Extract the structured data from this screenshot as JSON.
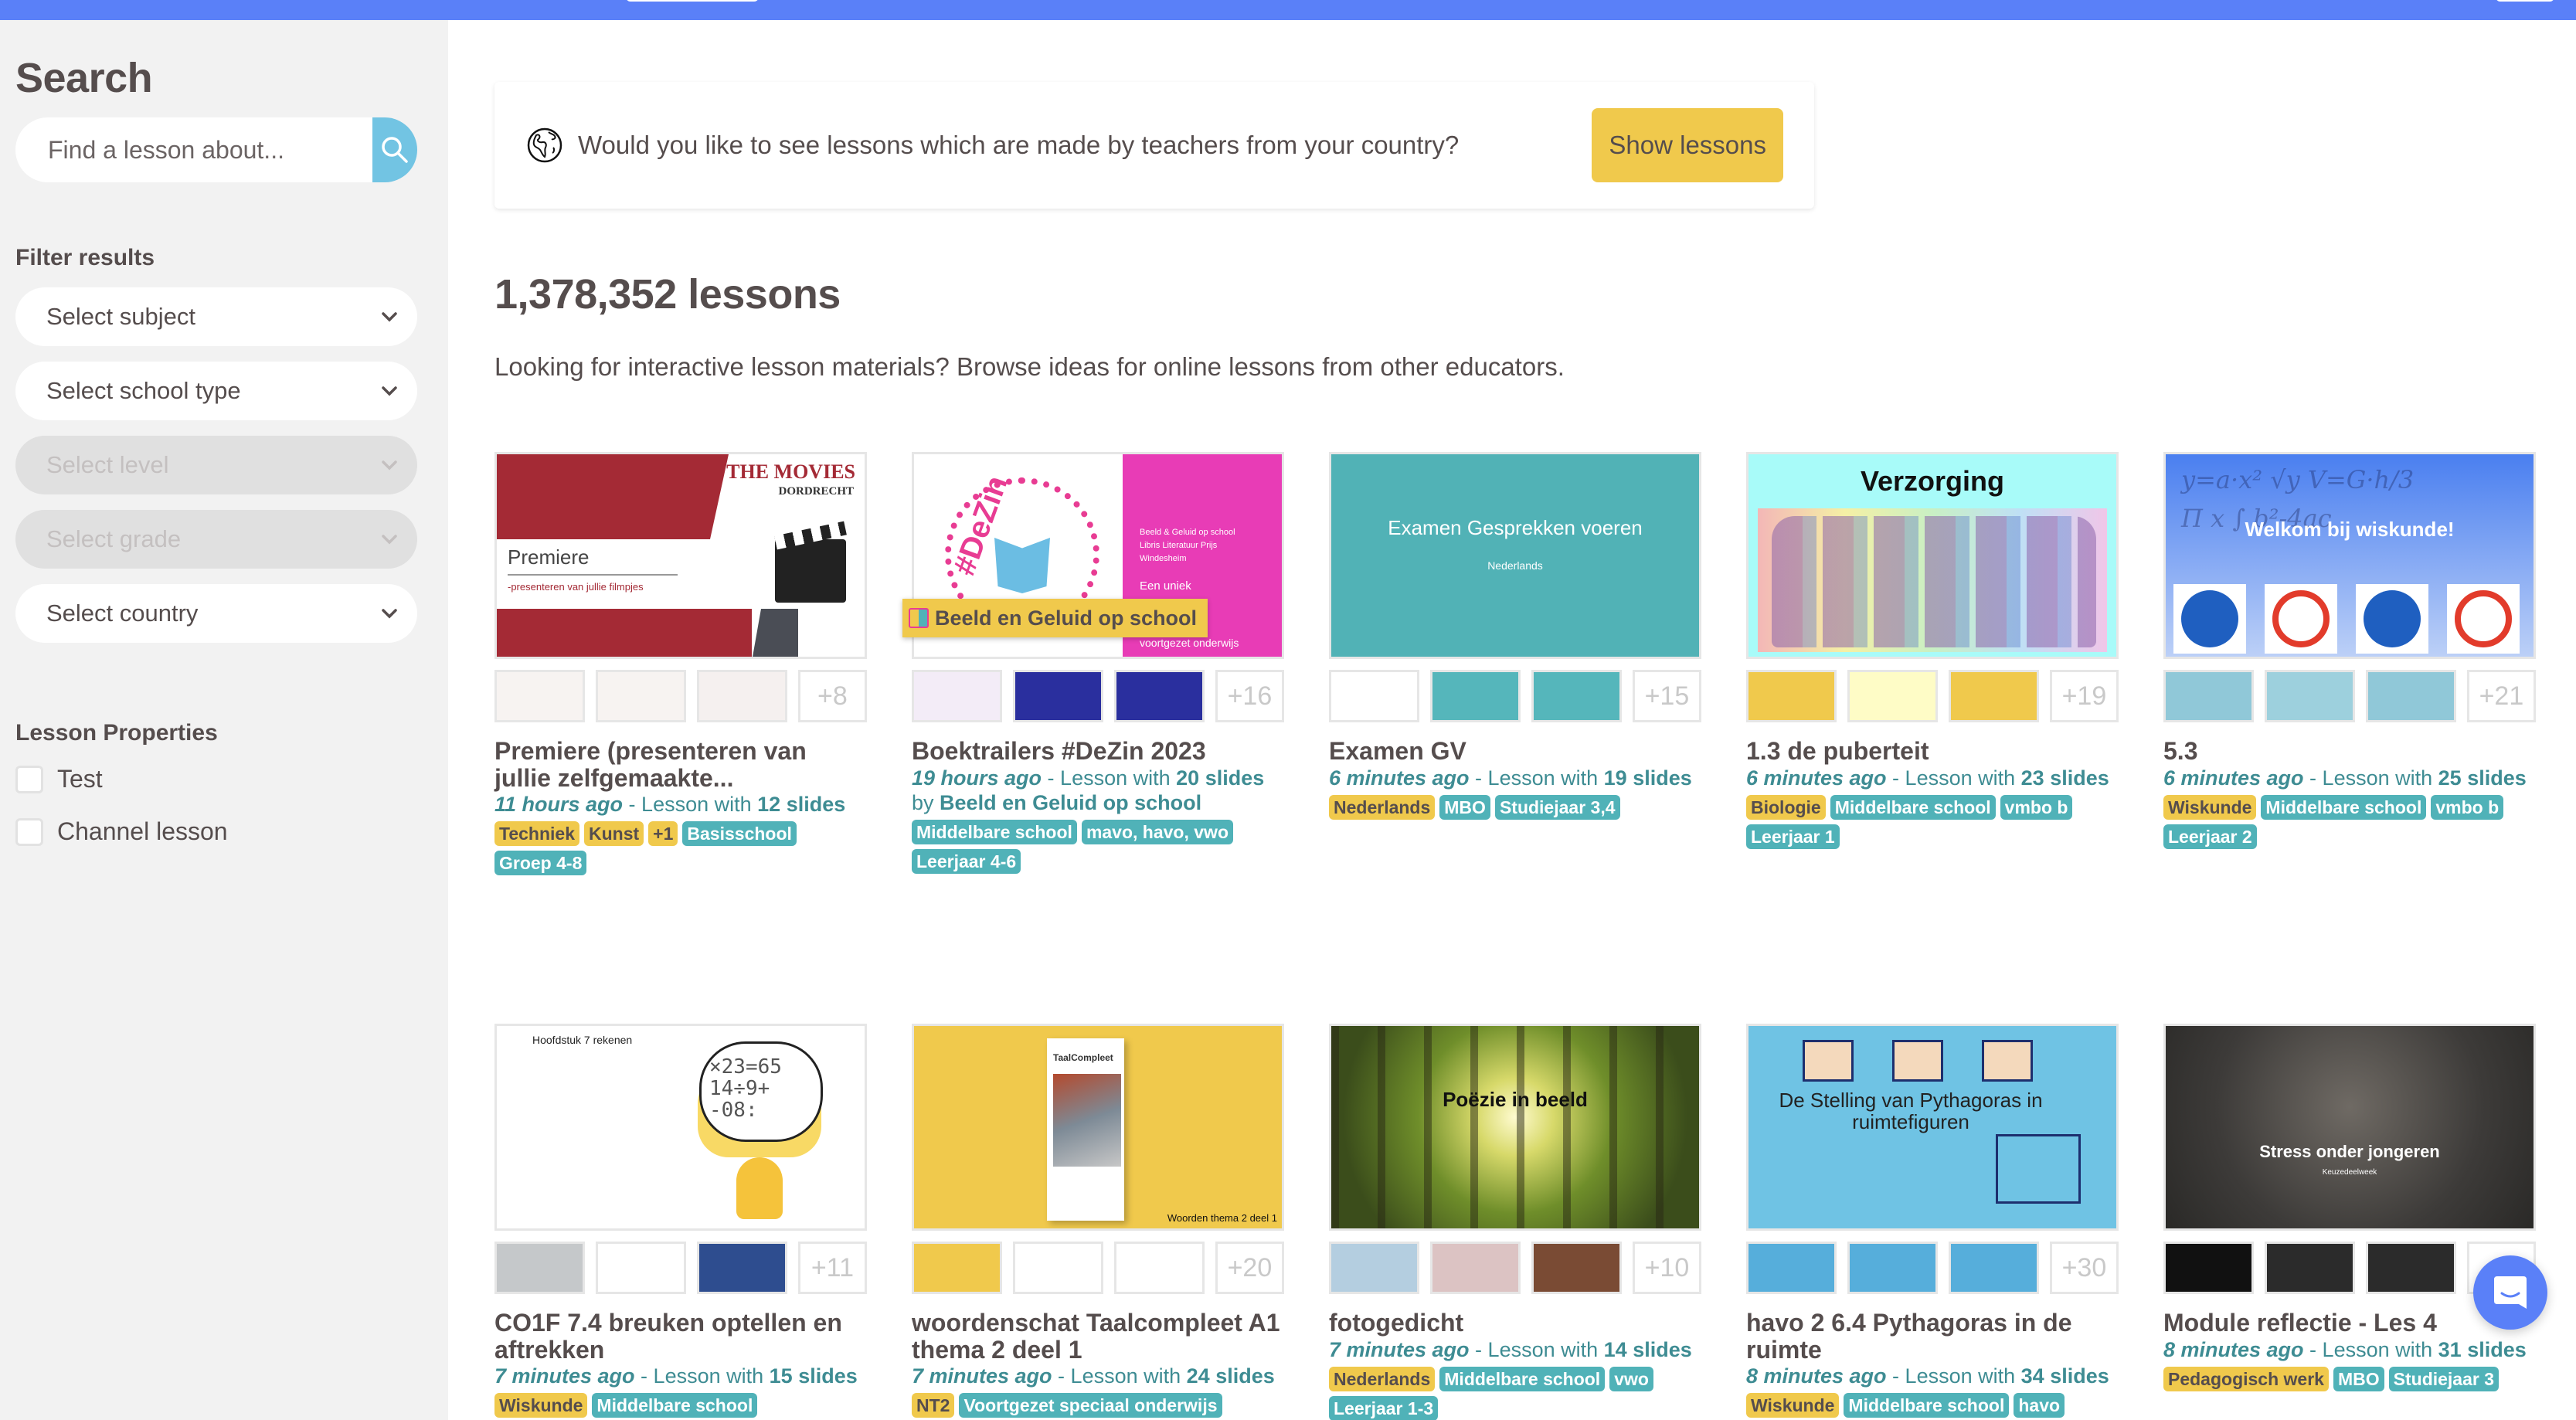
{
  "sidebar": {
    "title": "Search",
    "search": {
      "placeholder": "Find a lesson about...",
      "value": ""
    },
    "filter_title": "Filter results",
    "selects": [
      {
        "label": "Select subject",
        "disabled": false
      },
      {
        "label": "Select school type",
        "disabled": false
      },
      {
        "label": "Select level",
        "disabled": true
      },
      {
        "label": "Select grade",
        "disabled": true
      },
      {
        "label": "Select country",
        "disabled": false
      }
    ],
    "properties_title": "Lesson Properties",
    "checkboxes": [
      {
        "label": "Test",
        "checked": false
      },
      {
        "label": "Channel lesson",
        "checked": false
      }
    ]
  },
  "banner": {
    "text": "Would you like to see lessons which are made by teachers from your country?",
    "button": "Show lessons"
  },
  "results": {
    "count_title": "1,378,352 lessons",
    "description": "Looking for interactive lesson materials? Browse ideas for online lessons from other educators."
  },
  "colors": {
    "topbar": "#5a80f8",
    "accent_yellow": "#f0c94c",
    "accent_teal": "#50b2b8",
    "search_button": "#72c4e3",
    "text": "#554d4d"
  },
  "lessons": [
    {
      "title": "Premiere (presenteren van jullie zelfgemaakte...",
      "ago": "11 hours ago",
      "lesson_with": "Lesson with",
      "slides": "12 slides",
      "more": "+8",
      "thumb_text": [
        "Premiere",
        "-presenteren van jullie filmpjes",
        "THE MOVIES",
        "DORDRECHT"
      ],
      "tags": [
        {
          "text": "Techniek",
          "kind": "subj"
        },
        {
          "text": "Kunst",
          "kind": "subj"
        },
        {
          "text": "+1",
          "kind": "subj"
        },
        {
          "text": "Basisschool",
          "kind": "lvl"
        },
        {
          "text": "Groep 4-8",
          "kind": "lvl"
        }
      ]
    },
    {
      "title": "Boektrailers #DeZin 2023",
      "ago": "19 hours ago",
      "lesson_with": "Lesson with",
      "slides": "20 slides",
      "by": "by",
      "author": "Beeld en Geluid op school",
      "more": "+16",
      "thumb_text": [
        "#DeZin",
        "Beeld & Geluid op school",
        "Libris Literatuur Prijs",
        "Windesheim",
        "Een uniek",
        "voortgezet onderwijs"
      ],
      "tags": [
        {
          "text": "Middelbare school",
          "kind": "lvl"
        },
        {
          "text": "mavo, havo, vwo",
          "kind": "lvl"
        },
        {
          "text": "Leerjaar 4-6",
          "kind": "lvl"
        }
      ]
    },
    {
      "title": "Examen GV",
      "ago": "6 minutes ago",
      "lesson_with": "Lesson with",
      "slides": "19 slides",
      "more": "+15",
      "thumb_text": [
        "Examen Gesprekken voeren",
        "Nederlands"
      ],
      "tags": [
        {
          "text": "Nederlands",
          "kind": "subj"
        },
        {
          "text": "MBO",
          "kind": "lvl"
        },
        {
          "text": "Studiejaar 3,4",
          "kind": "lvl"
        }
      ]
    },
    {
      "title": "1.3 de puberteit",
      "ago": "6 minutes ago",
      "lesson_with": "Lesson with",
      "slides": "23 slides",
      "more": "+19",
      "thumb_text": [
        "Verzorging"
      ],
      "tags": [
        {
          "text": "Biologie",
          "kind": "subj"
        },
        {
          "text": "Middelbare school",
          "kind": "lvl"
        },
        {
          "text": "vmbo b",
          "kind": "lvl"
        },
        {
          "text": "Leerjaar 1",
          "kind": "lvl"
        }
      ]
    },
    {
      "title": "5.3",
      "ago": "6 minutes ago",
      "lesson_with": "Lesson with",
      "slides": "25 slides",
      "more": "+21",
      "thumb_text": [
        "Welkom bij wiskunde!"
      ],
      "tags": [
        {
          "text": "Wiskunde",
          "kind": "subj"
        },
        {
          "text": "Middelbare school",
          "kind": "lvl"
        },
        {
          "text": "vmbo b",
          "kind": "lvl"
        },
        {
          "text": "Leerjaar 2",
          "kind": "lvl"
        }
      ]
    },
    {
      "title": "CO1F 7.4 breuken optellen en aftrekken",
      "ago": "7 minutes ago",
      "lesson_with": "Lesson with",
      "slides": "15 slides",
      "more": "+11",
      "thumb_text": [
        "Hoofdstuk 7 rekenen"
      ],
      "tags": [
        {
          "text": "Wiskunde",
          "kind": "subj"
        },
        {
          "text": "Middelbare school",
          "kind": "lvl"
        }
      ]
    },
    {
      "title": "woordenschat Taalcompleet A1 thema 2 deel 1",
      "ago": "7 minutes ago",
      "lesson_with": "Lesson with",
      "slides": "24 slides",
      "more": "+20",
      "thumb_text": [
        "TaalCompleet",
        "Woorden thema 2 deel 1"
      ],
      "tags": [
        {
          "text": "NT2",
          "kind": "subj"
        },
        {
          "text": "Voortgezet speciaal onderwijs",
          "kind": "lvl"
        }
      ]
    },
    {
      "title": "fotogedicht",
      "ago": "7 minutes ago",
      "lesson_with": "Lesson with",
      "slides": "14 slides",
      "more": "+10",
      "thumb_text": [
        "Poëzie in beeld"
      ],
      "tags": [
        {
          "text": "Nederlands",
          "kind": "subj"
        },
        {
          "text": "Middelbare school",
          "kind": "lvl"
        },
        {
          "text": "vwo",
          "kind": "lvl"
        },
        {
          "text": "Leerjaar 1-3",
          "kind": "lvl"
        }
      ]
    },
    {
      "title": "havo 2 6.4 Pythagoras in de ruimte",
      "ago": "8 minutes ago",
      "lesson_with": "Lesson with",
      "slides": "34 slides",
      "more": "+30",
      "thumb_text": [
        "De Stelling van Pythagoras in ruimtefiguren"
      ],
      "tags": [
        {
          "text": "Wiskunde",
          "kind": "subj"
        },
        {
          "text": "Middelbare school",
          "kind": "lvl"
        },
        {
          "text": "havo",
          "kind": "lvl"
        }
      ]
    },
    {
      "title": "Module reflectie - Les 4",
      "ago": "8 minutes ago",
      "lesson_with": "Lesson with",
      "slides": "31 slides",
      "more": "+",
      "thumb_text": [
        "Stress onder jongeren",
        "Keuzedeelweek"
      ],
      "tags": [
        {
          "text": "Pedagogisch werk",
          "kind": "subj"
        },
        {
          "text": "MBO",
          "kind": "lvl"
        },
        {
          "text": "Studiejaar 3",
          "kind": "lvl"
        }
      ]
    }
  ]
}
